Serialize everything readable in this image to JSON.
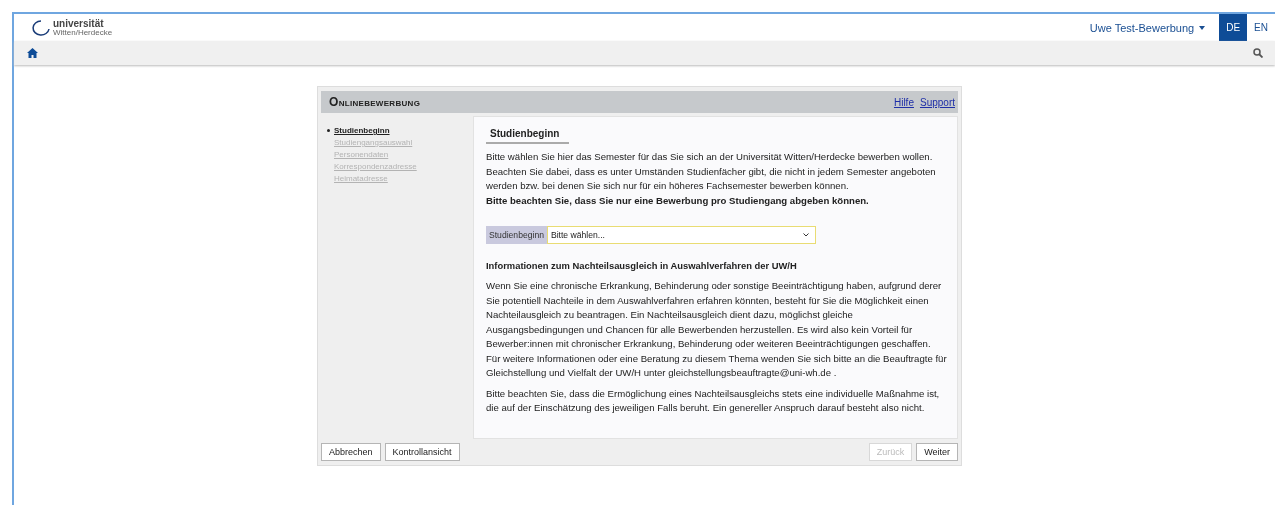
{
  "header": {
    "logo_text": "universität",
    "logo_subtext": "Witten/Herdecke",
    "user_menu": "Uwe Test-Bewerbung",
    "languages": [
      {
        "label": "DE",
        "selected": true
      },
      {
        "label": "EN",
        "selected": false
      }
    ]
  },
  "panel": {
    "title": "Onlinebewerbung",
    "links": [
      "Hilfe",
      "Support"
    ],
    "steps": [
      {
        "label": "Studienbeginn",
        "selected": true,
        "disabled": false
      },
      {
        "label": "Studiengangsauswahl",
        "selected": false,
        "disabled": true
      },
      {
        "label": "Personendaten",
        "selected": false,
        "disabled": true
      },
      {
        "label": "Korrespondenzadresse",
        "selected": false,
        "disabled": true
      },
      {
        "label": "Heimatadresse",
        "selected": false,
        "disabled": true
      }
    ],
    "section_title": "Studienbeginn",
    "intro": "Bitte wählen Sie hier das Semester für das Sie sich an der Universität Witten/Herdecke bewerben wollen. Beachten Sie dabei, dass es unter Umständen Studienfächer gibt, die nicht in jedem Semester angeboten werden bzw. bei denen Sie sich nur für ein höheres Fachsemester bewerben können.",
    "notice": "Bitte beachten Sie, dass Sie nur eine Bewerbung pro Studiengang abgeben können.",
    "field": {
      "label": "Studienbeginn",
      "value": "Bitte wählen..."
    },
    "info_title": "Informationen zum Nachteilsausgleich in Auswahlverfahren der UW/H",
    "info_paragraphs": [
      "Wenn Sie eine chronische Erkrankung, Behinderung oder sonstige Beeinträchtigung haben, aufgrund derer Sie potentiell Nachteile in dem Auswahlverfahren erfahren könnten, besteht für Sie die Möglichkeit einen Nachteilausgleich zu beantragen. Ein Nachteilsausgleich dient dazu, möglichst gleiche Ausgangsbedingungen und Chancen für alle Bewerbenden herzustellen. Es wird also kein Vorteil für Bewerber:innen mit chronischer Erkrankung, Behinderung oder weiteren Beeinträchtigungen geschaffen. Für weitere Informationen oder eine Beratung zu diesem Thema wenden Sie sich bitte an die Beauftragte für Gleichstellung und Vielfalt der UW/H unter gleichstellungsbeauftragte@uni-wh.de .",
      "Bitte beachten Sie, dass die Ermöglichung eines Nachteilsausgleichs stets eine individuelle Maßnahme ist, die auf der Einschätzung des jeweiligen Falls beruht. Ein genereller Anspruch darauf besteht also nicht."
    ],
    "buttons_left": [
      {
        "label": "Abbrechen",
        "disabled": false
      },
      {
        "label": "Kontrollansicht",
        "disabled": false
      }
    ],
    "buttons_right": [
      {
        "label": "Zurück",
        "disabled": true
      },
      {
        "label": "Weiter",
        "disabled": false
      }
    ]
  }
}
